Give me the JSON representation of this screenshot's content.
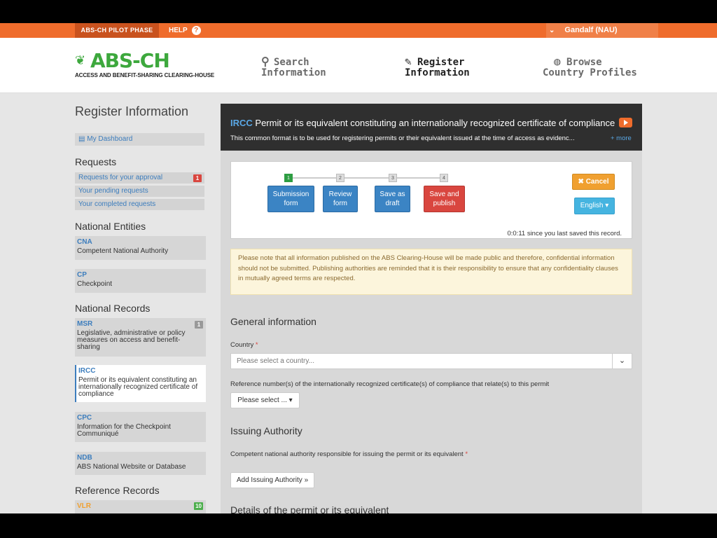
{
  "topbar": {
    "pilot_label": "ABS-CH PILOT PHASE",
    "help_label": "HELP",
    "help_icon": "?",
    "user_label": "Gandalf (NAU)"
  },
  "header": {
    "logo_text": "ABS-CH",
    "logo_subtitle": "ACCESS AND BENEFIT-SHARING CLEARING-HOUSE",
    "nav": {
      "search_line1": "Search",
      "search_line2": "Information",
      "register_line1": "Register",
      "register_line2": "Information",
      "browse_line1": "Browse",
      "browse_line2": "Country Profiles"
    }
  },
  "sidebar": {
    "title": "Register Information",
    "dashboard": "My Dashboard",
    "requests_heading": "Requests",
    "requests": [
      {
        "label": "Requests for your approval",
        "badge": "1"
      },
      {
        "label": "Your pending requests"
      },
      {
        "label": "Your completed requests"
      }
    ],
    "entities_heading": "National Entities",
    "entities": [
      {
        "code": "CNA",
        "desc": "Competent National Authority"
      },
      {
        "code": "CP",
        "desc": "Checkpoint"
      }
    ],
    "records_heading": "National Records",
    "records": [
      {
        "code": "MSR",
        "desc": "Legislative, administrative or policy measures on access and benefit-sharing",
        "badge": "1"
      },
      {
        "code": "IRCC",
        "desc": "Permit or its equivalent constituting an internationally recognized certificate of compliance"
      },
      {
        "code": "CPC",
        "desc": "Information for the Checkpoint Communiqué"
      },
      {
        "code": "NDB",
        "desc": "ABS National Website or Database"
      }
    ],
    "reference_heading": "Reference Records",
    "reference": [
      {
        "code": "VLR",
        "badge": "10"
      }
    ]
  },
  "main": {
    "tag": "IRCC",
    "title": "Permit or its equivalent constituting an internationally recognized certificate of compliance",
    "subtitle": "This common format is to be used for registering permits or their equivalent issued at the time of access as evidenc...",
    "more_label": "+ more",
    "steps": [
      {
        "num": "1",
        "line1": "Submission",
        "line2": "form"
      },
      {
        "num": "2",
        "line1": "Review",
        "line2": "form"
      },
      {
        "num": "3",
        "line1": "Save as",
        "line2": "draft"
      },
      {
        "num": "4",
        "line1": "Save and",
        "line2": "publish"
      }
    ],
    "cancel_label": "Cancel",
    "language_label": "English",
    "saved_text": "0:0:11 since you last saved this record.",
    "notice": "Please note that all information published on the ABS Clearing-House will be made public and therefore, confidential information should not be submitted. Publishing authorities are reminded that it is their responsibility to ensure that any confidentiality clauses in mutually agreed terms are respected.",
    "general_heading": "General information",
    "country_label": "Country",
    "country_placeholder": "Please select a country...",
    "reference_label": "Reference number(s) of the internationally recognized certificate(s) of compliance that relate(s) to this permit",
    "reference_select": "Please select ...",
    "issuing_heading": "Issuing Authority",
    "cna_label": "Competent national authority responsible for issuing the permit or its equivalent",
    "add_authority": "Add Issuing Authority »",
    "details_heading": "Details of the permit or its equivalent"
  },
  "colors": {
    "accent_orange": "#ef6c2c",
    "brand_green": "#3da83d",
    "link_blue": "#3c7dbd"
  }
}
